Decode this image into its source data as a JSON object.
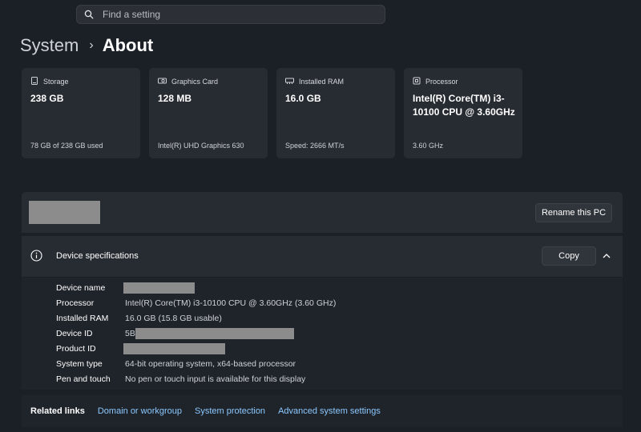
{
  "search": {
    "placeholder": "Find a setting"
  },
  "breadcrumb": {
    "parent": "System",
    "separator": "›",
    "current": "About"
  },
  "cards": [
    {
      "title": "Storage",
      "value": "238 GB",
      "sub": "78 GB of 238 GB used",
      "icon": "storage-icon"
    },
    {
      "title": "Graphics Card",
      "value": "128 MB",
      "sub": "Intel(R) UHD Graphics 630",
      "icon": "graphics-card-icon"
    },
    {
      "title": "Installed RAM",
      "value": "16.0 GB",
      "sub": "Speed: 2666 MT/s",
      "icon": "ram-icon"
    },
    {
      "title": "Processor",
      "value": "Intel(R) Core(TM) i3-10100 CPU @ 3.60GHz",
      "sub": "3.60 GHz",
      "icon": "processor-icon"
    }
  ],
  "name_panel": {
    "rename_label": "Rename this PC"
  },
  "specs": {
    "title": "Device specifications",
    "copy_label": "Copy",
    "rows": [
      {
        "label": "Device name",
        "value": ""
      },
      {
        "label": "Processor",
        "value": "Intel(R) Core(TM) i3-10100 CPU @ 3.60GHz (3.60 GHz)"
      },
      {
        "label": "Installed RAM",
        "value": "16.0 GB (15.8 GB usable)"
      },
      {
        "label": "Device ID",
        "value": "5B"
      },
      {
        "label": "Product ID",
        "value": ""
      },
      {
        "label": "System type",
        "value": "64-bit operating system, x64-based processor"
      },
      {
        "label": "Pen and touch",
        "value": "No pen or touch input is available for this display"
      }
    ]
  },
  "related": {
    "label": "Related links",
    "links": [
      "Domain or workgroup",
      "System protection",
      "Advanced system settings"
    ]
  },
  "colors": {
    "accent_link": "#8cc8ff",
    "background": "#1b2027",
    "card": "#272c33"
  }
}
